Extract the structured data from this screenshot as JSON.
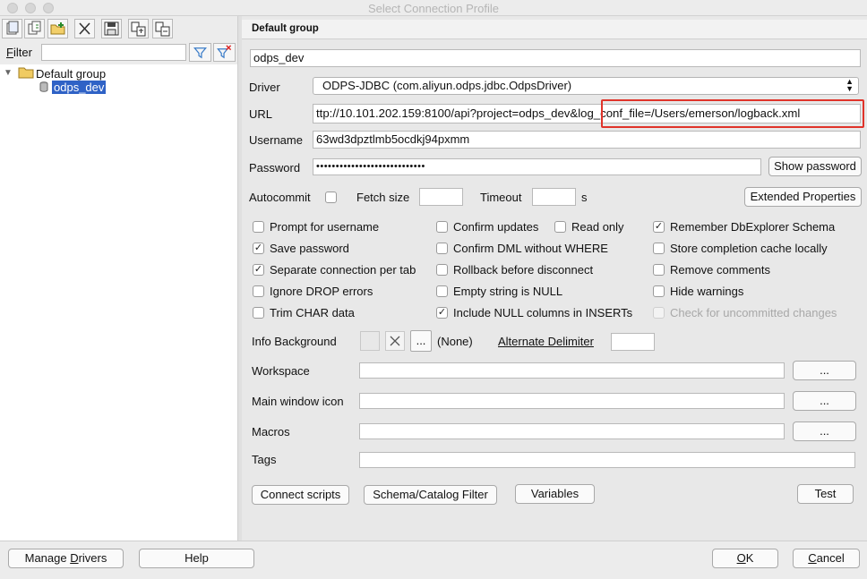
{
  "window": {
    "title": "Select Connection Profile"
  },
  "toolbar": {
    "icons": [
      "new-profile-icon",
      "copy-profile-icon",
      "new-group-icon",
      "delete-icon",
      "save-icon",
      "copy-to-clipboard-icon",
      "paste-icon"
    ]
  },
  "filter": {
    "label": "Filter",
    "label_rest": "ilter",
    "label_mnemonic": "F",
    "value": ""
  },
  "tree": {
    "group": "Default group",
    "profile": "odps_dev"
  },
  "form": {
    "group_title": "Default group",
    "name": "odps_dev",
    "driver_label": "Driver",
    "driver_value": "ODPS-JDBC (com.aliyun.odps.jdbc.OdpsDriver)",
    "url_label": "URL",
    "url_value": "ttp://10.101.202.159:8100/api?project=odps_dev&log_conf_file=/Users/emerson/logback.xml",
    "username_label": "Username",
    "username_value": "63wd3dpztlmb5ocdkj94pxmm",
    "password_label": "Password",
    "password_value": "••••••••••••••••••••••••••••",
    "show_password": "Show password",
    "autocommit_label": "Autocommit",
    "fetch_size_label": "Fetch size",
    "fetch_size_value": "",
    "timeout_label": "Timeout",
    "timeout_value": "",
    "timeout_unit": "s",
    "extended_properties": "Extended Properties"
  },
  "options": {
    "col1": [
      {
        "label": "Prompt for username",
        "checked": false
      },
      {
        "label": "Save password",
        "checked": true
      },
      {
        "label": "Separate connection per tab",
        "checked": true
      },
      {
        "label": "Ignore DROP errors",
        "checked": false
      },
      {
        "label": "Trim CHAR data",
        "checked": false
      }
    ],
    "col2": [
      {
        "label": "Confirm updates",
        "checked": false
      },
      {
        "label": "Confirm DML without WHERE",
        "checked": false
      },
      {
        "label": "Rollback before disconnect",
        "checked": false
      },
      {
        "label": "Empty string is NULL",
        "checked": false
      },
      {
        "label": "Include NULL columns in INSERTs",
        "checked": true
      }
    ],
    "read_only": {
      "label": "Read only",
      "checked": false
    },
    "col3": [
      {
        "label": "Remember DbExplorer Schema",
        "checked": true
      },
      {
        "label": "Store completion cache locally",
        "checked": false
      },
      {
        "label": "Remove comments",
        "checked": false
      },
      {
        "label": "Hide warnings",
        "checked": false
      },
      {
        "label": "Check for uncommitted changes",
        "checked": false,
        "disabled": true
      }
    ]
  },
  "info": {
    "info_background_label": "Info Background",
    "ellipsis": "...",
    "none_label": "(None)",
    "alternate_delimiter": "Alternate Delimiter",
    "alternate_delimiter_value": "",
    "workspace_label": "Workspace",
    "workspace_value": "",
    "main_window_icon_label": "Main window icon",
    "main_window_icon_value": "",
    "macros_label": "Macros",
    "macros_value": "",
    "tags_label": "Tags",
    "tags_value": ""
  },
  "actions": {
    "connect_scripts": "Connect scripts",
    "schema_catalog_filter": "Schema/Catalog Filter",
    "variables": "Variables",
    "test": "Test"
  },
  "footer": {
    "manage_drivers": "Manage Drivers",
    "manage_drivers_pre": "Manage ",
    "manage_drivers_mn": "D",
    "manage_drivers_post": "rivers",
    "help": "Help",
    "ok": "OK",
    "ok_mn": "O",
    "ok_post": "K",
    "cancel": "Cancel",
    "cancel_mn": "C",
    "cancel_post": "ancel"
  },
  "colors": {
    "highlight": "#e0332a",
    "selection": "#2f62c6"
  }
}
